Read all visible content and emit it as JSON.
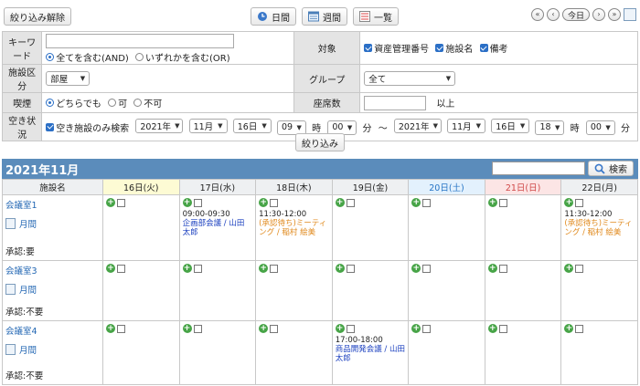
{
  "toolbar": {
    "reset_label": "絞り込み解除",
    "views": [
      {
        "label": "日間",
        "icon": "clock-icon"
      },
      {
        "label": "週間",
        "icon": "calendar-week-icon"
      },
      {
        "label": "一覧",
        "icon": "list-icon"
      }
    ],
    "today_label": "今日"
  },
  "form": {
    "keyword_label": "キーワード",
    "keyword_value": "",
    "keyword_options": [
      "全てを含む(AND)",
      "いずれかを含む(OR)"
    ],
    "target_label": "対象",
    "target_options": [
      "資産管理番号",
      "施設名",
      "備考"
    ],
    "facility_type_label": "施設区分",
    "facility_type_value": "部屋",
    "group_label": "グループ",
    "group_value": "全て",
    "smoking_label": "喫煙",
    "smoking_options": [
      "どちらでも",
      "可",
      "不可"
    ],
    "seats_label": "座席数",
    "seats_value": "",
    "seats_suffix": "以上",
    "availability_label": "空き状況",
    "availability_check": "空き施設のみ検索",
    "from": {
      "year": "2021年",
      "month": "11月",
      "day": "16日",
      "hour": "09",
      "minute": "00"
    },
    "to": {
      "year": "2021年",
      "month": "11月",
      "day": "16日",
      "hour": "18",
      "minute": "00"
    },
    "hour_unit": "時",
    "minute_unit": "分",
    "range_sep": "〜",
    "filter_label": "絞り込み"
  },
  "calendar": {
    "month_title": "2021年11月",
    "search_placeholder": "",
    "search_label": "検索",
    "facility_header": "施設名",
    "days": [
      {
        "label": "16日(火)",
        "kind": "today"
      },
      {
        "label": "17日(水)",
        "kind": "weekday"
      },
      {
        "label": "18日(木)",
        "kind": "weekday"
      },
      {
        "label": "19日(金)",
        "kind": "weekday"
      },
      {
        "label": "20日(土)",
        "kind": "sat"
      },
      {
        "label": "21日(日)",
        "kind": "sun"
      },
      {
        "label": "22日(月)",
        "kind": "weekday"
      }
    ],
    "month_link": "月間",
    "rows": [
      {
        "facility": "会議室1",
        "approval": "承認:要",
        "events": [
          [],
          [
            {
              "time": "09:00-09:30",
              "title": "企画部会議 / 山田 太郎",
              "pending": false
            }
          ],
          [
            {
              "time": "11:30-12:00",
              "title": "(承認待ち)ミーティング / 稲村 絵美",
              "pending": true
            }
          ],
          [],
          [],
          [],
          [
            {
              "time": "11:30-12:00",
              "title": "(承認待ち)ミーティング / 稲村 絵美",
              "pending": true
            }
          ]
        ]
      },
      {
        "facility": "会議室3",
        "approval": "承認:不要",
        "events": [
          [],
          [],
          [],
          [],
          [],
          [],
          []
        ]
      },
      {
        "facility": "会議室4",
        "approval": "承認:不要",
        "events": [
          [],
          [],
          [],
          [
            {
              "time": "17:00-18:00",
              "title": "商品開発会議 / 山田 太郎",
              "pending": false
            }
          ],
          [],
          [],
          []
        ]
      }
    ]
  }
}
